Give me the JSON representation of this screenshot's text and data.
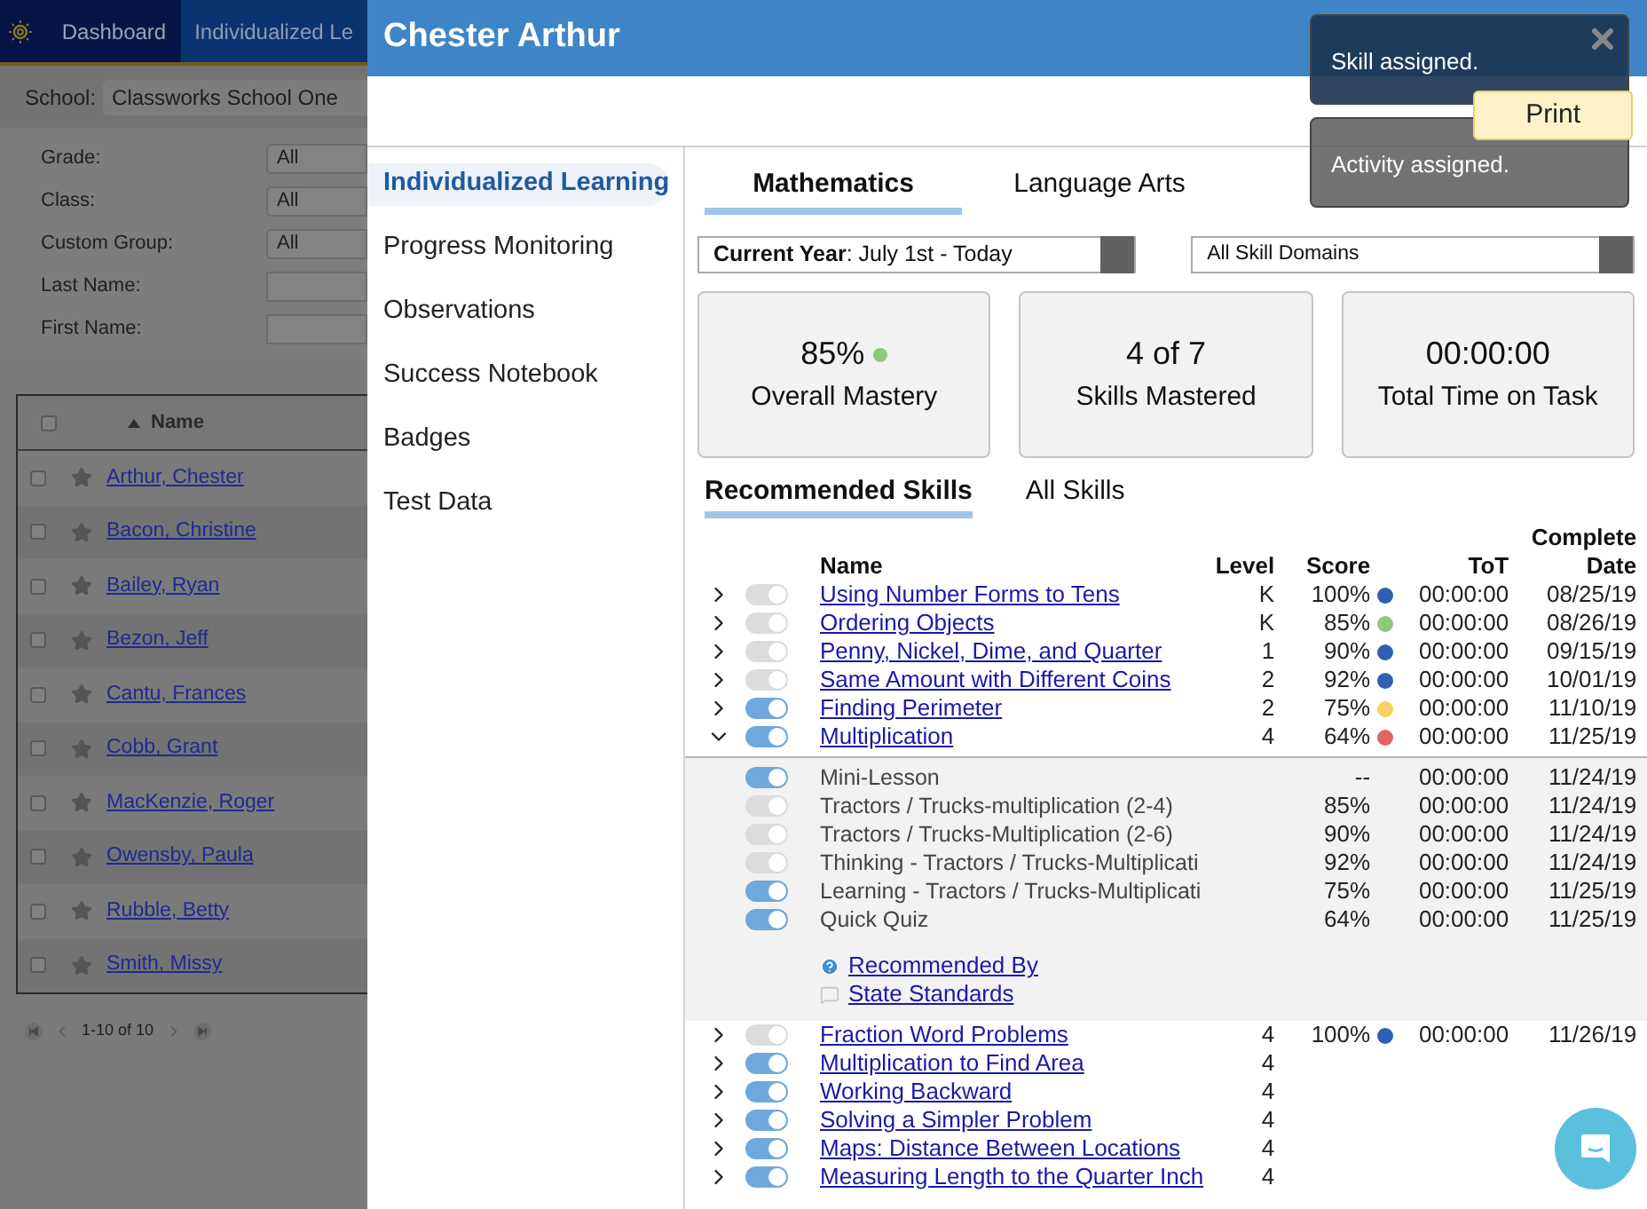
{
  "background_app": {
    "nav_tabs": [
      {
        "label": "Dashboard",
        "selected": false
      },
      {
        "label": "Individualized Le",
        "selected": true
      }
    ],
    "school": {
      "label": "School:",
      "value": "Classworks School One"
    },
    "filters": [
      {
        "label": "Grade:",
        "kind": "select",
        "value": "All"
      },
      {
        "label": "Class:",
        "kind": "select",
        "value": "All"
      },
      {
        "label": "Custom Group:",
        "kind": "select",
        "value": "All"
      },
      {
        "label": "Last Name:",
        "kind": "input"
      },
      {
        "label": "First Name:",
        "kind": "input"
      }
    ],
    "student_table": {
      "header": "Name",
      "all_checked": false,
      "rows": [
        {
          "name": "Arthur, Chester",
          "checked": false
        },
        {
          "name": "Bacon, Christine",
          "checked": false
        },
        {
          "name": "Bailey, Ryan",
          "checked": false
        },
        {
          "name": "Bezon, Jeff",
          "checked": false
        },
        {
          "name": "Cantu, Frances",
          "checked": false
        },
        {
          "name": "Cobb, Grant",
          "checked": false
        },
        {
          "name": "MacKenzie, Roger",
          "checked": false
        },
        {
          "name": "Owensby, Paula",
          "checked": false
        },
        {
          "name": "Rubble, Betty",
          "checked": false
        },
        {
          "name": "Smith, Missy",
          "checked": false
        }
      ]
    },
    "pager": "1-10 of 10"
  },
  "modal": {
    "title": "Chester Arthur",
    "print_label": "Print",
    "nav": [
      {
        "label": "Individualized Learning",
        "selected": true
      },
      {
        "label": "Progress Monitoring",
        "selected": false
      },
      {
        "label": "Observations",
        "selected": false
      },
      {
        "label": "Success Notebook",
        "selected": false
      },
      {
        "label": "Badges",
        "selected": false
      },
      {
        "label": "Test Data",
        "selected": false
      }
    ],
    "subject_tabs": [
      {
        "label": "Mathematics",
        "selected": true
      },
      {
        "label": "Language Arts",
        "selected": false
      }
    ],
    "period_select": "**Current Year**: July 1st - Today",
    "domain_select": "All Skill Domains",
    "stats": [
      {
        "value": "85%",
        "label": "Overall Mastery",
        "color": "#8cc97a"
      },
      {
        "value": "4 of 7",
        "label": "Skills Mastered"
      },
      {
        "value": "00:00:00",
        "label": "Total Time on Task"
      }
    ],
    "skill_tabs": [
      {
        "label": "Recommended Skills",
        "selected": true
      },
      {
        "label": "All Skills",
        "selected": false
      }
    ],
    "skills_table": {
      "columns": [
        "Name",
        "Level",
        "Score",
        "ToT",
        "Complete Date"
      ],
      "rows": [
        {
          "name": "Using Number Forms to Tens",
          "level": "K",
          "score": "100%",
          "color": "#2f5fb3",
          "tot": "00:00:00",
          "date": "08/25/19",
          "toggle": {
            "color": "#dcdcdc"
          },
          "expanded": false
        },
        {
          "name": "Ordering Objects",
          "level": "K",
          "score": "85%",
          "color": "#8cc97a",
          "tot": "00:00:00",
          "date": "08/26/19",
          "toggle": {
            "color": "#dcdcdc"
          },
          "expanded": false
        },
        {
          "name": "Penny, Nickel, Dime, and Quarter",
          "level": "1",
          "score": "90%",
          "color": "#2f5fb3",
          "tot": "00:00:00",
          "date": "09/15/19",
          "toggle": {
            "color": "#dcdcdc"
          },
          "expanded": false
        },
        {
          "name": "Same Amount with Different Coins",
          "level": "2",
          "score": "92%",
          "color": "#2f5fb3",
          "tot": "00:00:00",
          "date": "10/01/19",
          "toggle": {
            "color": "#dcdcdc"
          },
          "expanded": false
        },
        {
          "name": "Finding Perimeter",
          "level": "2",
          "score": "75%",
          "color": "#f7d260",
          "tot": "00:00:00",
          "date": "11/10/19",
          "toggle": {
            "color": "#6fa8dc"
          },
          "expanded": false
        },
        {
          "name": "Multiplication",
          "level": "4",
          "score": "64%",
          "color": "#e06666",
          "tot": "00:00:00",
          "date": "11/25/19",
          "toggle": {
            "color": "#6fa8dc"
          },
          "expanded": true,
          "activities": [
            {
              "name": "Mini-Lesson",
              "score": "--",
              "tot": "00:00:00",
              "date": "11/24/19",
              "toggle": {
                "color": "#6fa8dc"
              }
            },
            {
              "name": "Tractors / Trucks-multiplication (2-4)",
              "score": "85%",
              "tot": "00:00:00",
              "date": "11/24/19",
              "toggle": {
                "color": "#dcdcdc"
              }
            },
            {
              "name": "Tractors / Trucks-Multiplication (2-6)",
              "score": "90%",
              "tot": "00:00:00",
              "date": "11/24/19",
              "toggle": {
                "color": "#dcdcdc"
              }
            },
            {
              "name": "Thinking - Tractors / Trucks-Multiplicati",
              "score": "92%",
              "tot": "00:00:00",
              "date": "11/24/19",
              "toggle": {
                "color": "#dcdcdc"
              }
            },
            {
              "name": "Learning - Tractors / Trucks-Multiplicati",
              "score": "75%",
              "tot": "00:00:00",
              "date": "11/25/19",
              "toggle": {
                "color": "#6fa8dc"
              }
            },
            {
              "name": "Quick Quiz",
              "score": "64%",
              "tot": "00:00:00",
              "date": "11/25/19",
              "toggle": {
                "color": "#6fa8dc"
              }
            }
          ],
          "links": [
            {
              "kind": "help",
              "label": "Recommended By"
            },
            {
              "kind": "standards",
              "label": "State Standards"
            }
          ]
        },
        {
          "name": "Fraction Word Problems",
          "level": "4",
          "score": "100%",
          "color": "#2f5fb3",
          "tot": "00:00:00",
          "date": "11/26/19",
          "toggle": {
            "color": "#dcdcdc"
          },
          "expanded": false
        },
        {
          "name": "Multiplication to Find Area",
          "level": "4",
          "toggle": {
            "color": "#6fa8dc"
          },
          "expanded": false
        },
        {
          "name": "Working Backward",
          "level": "4",
          "toggle": {
            "color": "#6fa8dc"
          },
          "expanded": false
        },
        {
          "name": "Solving a Simpler Problem",
          "level": "4",
          "toggle": {
            "color": "#6fa8dc"
          },
          "expanded": false
        },
        {
          "name": "Maps: Distance Between Locations",
          "level": "4",
          "toggle": {
            "color": "#6fa8dc"
          },
          "expanded": false
        },
        {
          "name": "Measuring Length to the Quarter Inch",
          "level": "4",
          "toggle": {
            "color": "#6fa8dc"
          },
          "expanded": false
        }
      ]
    }
  },
  "toasts": [
    {
      "text": "Skill assigned.",
      "closable": true
    },
    {
      "text": "Activity assigned.",
      "closable": false
    }
  ]
}
